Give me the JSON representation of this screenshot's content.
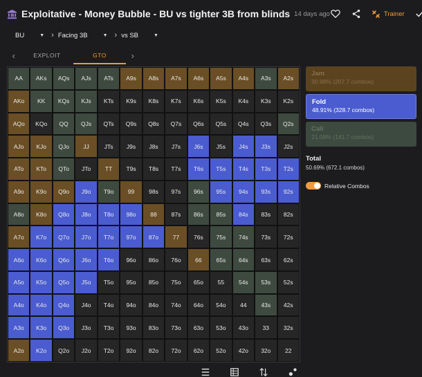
{
  "header": {
    "title": "Exploitative - Money Bubble - BU vs tighter 3B from blinds",
    "timestamp": "14 days ago",
    "trainer_label": "Trainer"
  },
  "filters": {
    "position": "BU",
    "action": "Facing 3B",
    "opponent": "vs SB"
  },
  "tabs": [
    "EXPLOIT",
    "GTO"
  ],
  "active_tab": "GTO",
  "colors": {
    "fold": "#4a5cd0",
    "call": "#3e4a40",
    "jam": "#6a4e25",
    "accent": "#f09a3e"
  },
  "grid": {
    "rows": [
      [
        "AA",
        "AKs",
        "AQs",
        "AJs",
        "ATs",
        "A9s",
        "A8s",
        "A7s",
        "A6s",
        "A5s",
        "A4s",
        "A3s",
        "A2s"
      ],
      [
        "AKo",
        "KK",
        "KQs",
        "KJs",
        "KTs",
        "K9s",
        "K8s",
        "K7s",
        "K6s",
        "K5s",
        "K4s",
        "K3s",
        "K2s"
      ],
      [
        "AQo",
        "KQo",
        "QQ",
        "QJs",
        "QTs",
        "Q9s",
        "Q8s",
        "Q7s",
        "Q6s",
        "Q5s",
        "Q4s",
        "Q3s",
        "Q2s"
      ],
      [
        "AJo",
        "KJo",
        "QJo",
        "JJ",
        "JTs",
        "J9s",
        "J8s",
        "J7s",
        "J6s",
        "J5s",
        "J4s",
        "J3s",
        "J2s"
      ],
      [
        "ATo",
        "KTo",
        "QTo",
        "JTo",
        "TT",
        "T9s",
        "T8s",
        "T7s",
        "T6s",
        "T5s",
        "T4s",
        "T3s",
        "T2s"
      ],
      [
        "A9o",
        "K9o",
        "Q9o",
        "J9o",
        "T9o",
        "99",
        "98s",
        "97s",
        "96s",
        "95s",
        "94s",
        "93s",
        "92s"
      ],
      [
        "A8o",
        "K8o",
        "Q8o",
        "J8o",
        "T8o",
        "98o",
        "88",
        "87s",
        "86s",
        "85s",
        "84s",
        "83s",
        "82s"
      ],
      [
        "A7o",
        "K7o",
        "Q7o",
        "J7o",
        "T7o",
        "97o",
        "87o",
        "77",
        "76s",
        "75s",
        "74s",
        "73s",
        "72s"
      ],
      [
        "A6o",
        "K6o",
        "Q6o",
        "J6o",
        "T6o",
        "96o",
        "86o",
        "76o",
        "66",
        "65s",
        "64s",
        "63s",
        "62s"
      ],
      [
        "A5o",
        "K5o",
        "Q5o",
        "J5o",
        "T5o",
        "95o",
        "85o",
        "75o",
        "65o",
        "55",
        "54s",
        "53s",
        "52s"
      ],
      [
        "A4o",
        "K4o",
        "Q4o",
        "J4o",
        "T4o",
        "94o",
        "84o",
        "74o",
        "64o",
        "54o",
        "44",
        "43s",
        "42s"
      ],
      [
        "A3o",
        "K3o",
        "Q3o",
        "J3o",
        "T3o",
        "93o",
        "83o",
        "73o",
        "63o",
        "53o",
        "43o",
        "33",
        "32s"
      ],
      [
        "A2o",
        "K2o",
        "Q2o",
        "J2o",
        "T2o",
        "92o",
        "82o",
        "72o",
        "62o",
        "52o",
        "42o",
        "32o",
        "22"
      ]
    ],
    "mix": [
      [
        "call",
        "call",
        "call",
        "call",
        "call",
        "jam",
        "jam",
        "jam",
        "jam",
        "jam",
        "jam",
        "call",
        "jam"
      ],
      [
        "jam",
        "call",
        "call",
        "call",
        "empty",
        "empty",
        "empty",
        "empty",
        "empty",
        "empty",
        "empty",
        "empty",
        "empty"
      ],
      [
        "jam",
        "empty",
        "call",
        "call",
        "empty",
        "empty",
        "empty",
        "empty",
        "empty",
        "empty",
        "empty",
        "empty",
        "call"
      ],
      [
        "jam",
        "jam",
        "call",
        "jam",
        "empty",
        "empty",
        "empty",
        "empty",
        "fold",
        "empty",
        "fold",
        "fold",
        "empty"
      ],
      [
        "jam",
        "jam",
        "call",
        "empty",
        "jam",
        "empty",
        "empty",
        "empty",
        "fold",
        "fold",
        "fold",
        "fold",
        "fold"
      ],
      [
        "jam",
        "jam",
        "jam",
        "fold",
        "call",
        "jam",
        "empty",
        "empty",
        "call",
        "fold",
        "fold",
        "fold",
        "fold"
      ],
      [
        "call",
        "jam",
        "fold",
        "fold",
        "fold",
        "fold",
        "jam",
        "empty",
        "call",
        "call",
        "fold",
        "empty",
        "empty"
      ],
      [
        "jam",
        "fold",
        "fold",
        "fold",
        "fold",
        "fold",
        "fold",
        "jam",
        "empty",
        "call",
        "call",
        "empty",
        "empty"
      ],
      [
        "fold",
        "fold",
        "fold",
        "fold",
        "fold",
        "empty",
        "empty",
        "empty",
        "jam",
        "call",
        "call",
        "empty",
        "empty"
      ],
      [
        "fold",
        "fold",
        "fold",
        "fold",
        "empty",
        "empty",
        "empty",
        "empty",
        "empty",
        "empty",
        "call",
        "call",
        "empty"
      ],
      [
        "fold",
        "fold",
        "fold",
        "empty",
        "empty",
        "empty",
        "empty",
        "empty",
        "empty",
        "empty",
        "empty",
        "call",
        "empty"
      ],
      [
        "fold",
        "fold",
        "fold",
        "empty",
        "empty",
        "empty",
        "empty",
        "empty",
        "empty",
        "empty",
        "empty",
        "empty",
        "empty"
      ],
      [
        "jam",
        "fold",
        "empty",
        "empty",
        "empty",
        "empty",
        "empty",
        "empty",
        "empty",
        "empty",
        "empty",
        "empty",
        "empty"
      ]
    ]
  },
  "actions": [
    {
      "name": "Jam",
      "detail": "30.98% (207.7 combos)"
    },
    {
      "name": "Fold",
      "detail": "48.91% (328.7 combos)"
    },
    {
      "name": "Call",
      "detail": "21.09% (141.7 combos)"
    }
  ],
  "total": {
    "label": "Total",
    "detail": "50.69% (672.1 combos)"
  },
  "relative_combos_label": "Relative Combos"
}
